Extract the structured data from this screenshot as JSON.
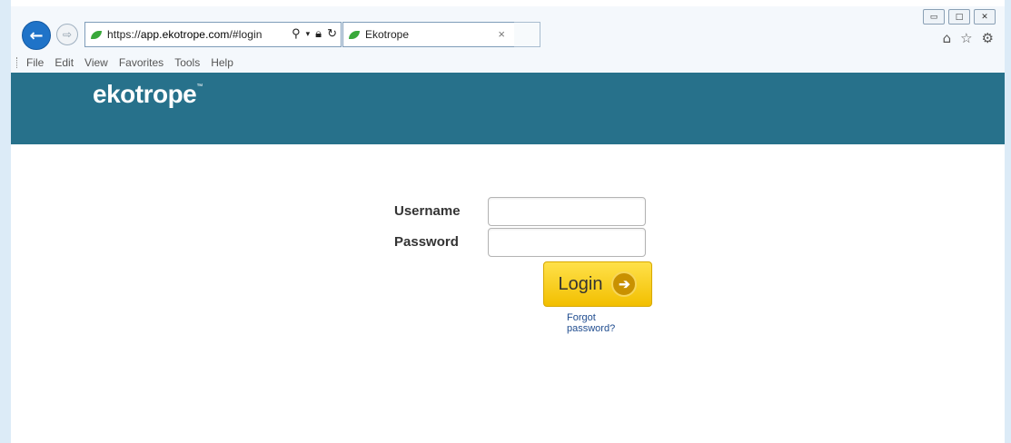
{
  "browser": {
    "url_prefix": "https://",
    "url_host": "app.ekotrope.com",
    "url_path": "/#login",
    "tab_title": "Ekotrope",
    "tab_close": "×",
    "menu": [
      "File",
      "Edit",
      "View",
      "Favorites",
      "Tools",
      "Help"
    ],
    "icons": {
      "back": "back-arrow-icon",
      "forward": "forward-arrow-icon",
      "search": "search-icon",
      "lock": "lock-icon",
      "refresh": "refresh-icon",
      "home": "home-icon",
      "favorites": "star-icon",
      "settings": "gear-icon"
    }
  },
  "window_controls": {
    "minimize": "▭",
    "maximize": "□",
    "close": "✕"
  },
  "header": {
    "brand": "ekotrope",
    "trademark": "™",
    "color": "#27718b"
  },
  "login": {
    "username_label": "Username",
    "password_label": "Password",
    "username_value": "",
    "password_value": "",
    "button_label": "Login",
    "forgot_link": "Forgot password?",
    "button_color": "#f2bf00"
  }
}
